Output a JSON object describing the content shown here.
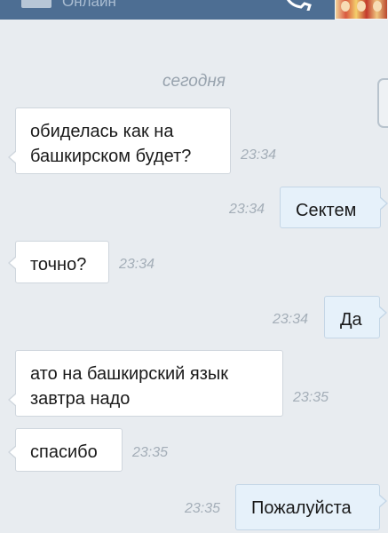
{
  "header": {
    "status": "Онлайн",
    "call_icon": "call-icon",
    "back_icon": "back-icon"
  },
  "divider": {
    "date_label": "сегодня"
  },
  "messages": [
    {
      "direction": "in",
      "text": "обиделась как на\nбашкирском будет?",
      "time": "23:34"
    },
    {
      "direction": "out",
      "text": "Сектем",
      "time": "23:34"
    },
    {
      "direction": "in",
      "text": "точно?",
      "time": "23:34"
    },
    {
      "direction": "out",
      "text": "Да",
      "time": "23:34"
    },
    {
      "direction": "in",
      "text": "ато на башкирский язык\nзавтра надо",
      "time": "23:35"
    },
    {
      "direction": "in",
      "text": "спасибо",
      "time": "23:35"
    },
    {
      "direction": "out",
      "text": "Пожалуйста",
      "time": "23:35"
    }
  ],
  "colors": {
    "header": "#4d6e93",
    "background": "#e8ecf0",
    "incoming_bubble": "#ffffff",
    "outgoing_bubble": "#e6f1fa",
    "timestamp": "#a4aeb8"
  }
}
